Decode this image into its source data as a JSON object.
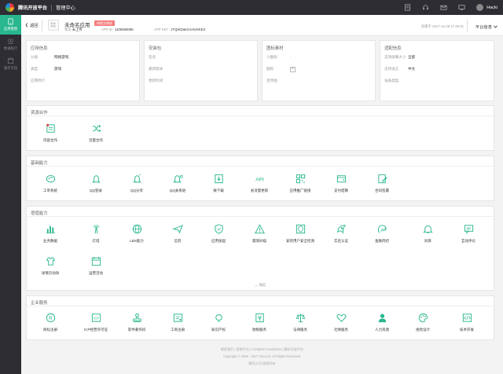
{
  "topbar": {
    "brand": "腾讯开放平台",
    "console": "管理中心",
    "user": "Hacki"
  },
  "sidebar": {
    "items": [
      {
        "label": "应用管理",
        "icon": "app-icon",
        "active": true
      },
      {
        "label": "数据统计",
        "icon": "chart-icon",
        "active": false
      },
      {
        "label": "服务市场",
        "icon": "store-icon",
        "active": false
      }
    ]
  },
  "app": {
    "back": "返回",
    "name": "未命名应用",
    "badge": "待提交审核",
    "status_label": "状态",
    "status_value": "未上传",
    "appid_label": "APP ID",
    "appid_value": "1106550096",
    "appkey_label": "APP KEY",
    "appkey_value": "zTQIKDaKrncHUSKE3",
    "created": "创建于 2017-12-28 17:49:31",
    "platform": "平台信息"
  },
  "cards": [
    {
      "title": "应用信息",
      "rows": [
        {
          "label": "分类",
          "value": "网络游戏"
        },
        {
          "label": "类型",
          "value": "游戏"
        },
        {
          "label": "应用简介",
          "value": ""
        }
      ]
    },
    {
      "title": "安装包",
      "rows": [
        {
          "label": "包名",
          "value": ""
        },
        {
          "label": "最新版本",
          "value": ""
        },
        {
          "label": "更新时间",
          "value": ""
        }
      ]
    },
    {
      "title": "图标素材",
      "rows": [
        {
          "label": "小图标",
          "value": ""
        },
        {
          "label": "图标",
          "value": ""
        },
        {
          "label": "宣传图",
          "value": ""
        }
      ]
    },
    {
      "title": "适配信息",
      "rows": [
        {
          "label": "支持屏幕大小",
          "value": "全部"
        },
        {
          "label": "支持语言",
          "value": "中文"
        },
        {
          "label": "设备类型",
          "value": ""
        }
      ]
    }
  ],
  "sections": {
    "resources": {
      "title": "资源合作",
      "items": [
        {
          "label": "内容合作",
          "icon": "content-icon"
        },
        {
          "label": "流量合作",
          "icon": "shuffle-icon"
        }
      ]
    },
    "basic": {
      "title": "基础能力",
      "items": [
        {
          "label": "工单系统",
          "icon": "ticket-icon"
        },
        {
          "label": "QQ登录",
          "icon": "qq-icon"
        },
        {
          "label": "QQ分享",
          "icon": "qq-share-icon"
        },
        {
          "label": "QQ关系链",
          "icon": "qq-relation-icon"
        },
        {
          "label": "微下载",
          "icon": "download-icon"
        },
        {
          "label": "省流量更新",
          "icon": "api-icon"
        },
        {
          "label": "应用推广链接",
          "icon": "qrcode-icon"
        },
        {
          "label": "支付结算",
          "icon": "wallet-icon"
        },
        {
          "label": "合同签署",
          "icon": "contract-icon"
        }
      ]
    },
    "enhanced": {
      "title": "增值能力",
      "items": [
        {
          "label": "业务数据",
          "icon": "bar-chart-icon"
        },
        {
          "label": "灯塔",
          "icon": "tower-icon"
        },
        {
          "label": "LBS能力",
          "icon": "globe-icon"
        },
        {
          "label": "信鸽",
          "icon": "pigeon-icon"
        },
        {
          "label": "应用加固",
          "icon": "shield-icon"
        },
        {
          "label": "漏洞扫描",
          "icon": "warning-icon"
        },
        {
          "label": "安装用户安全检测",
          "icon": "security-check-icon"
        },
        {
          "label": "实名认证",
          "icon": "id-icon"
        },
        {
          "label": "金融风控",
          "icon": "risk-icon"
        },
        {
          "label": "天御",
          "icon": "bell-icon"
        },
        {
          "label": "互动评论",
          "icon": "comment-icon"
        },
        {
          "label": "详情页动效",
          "icon": "gift-icon"
        },
        {
          "label": "运营活动",
          "icon": "calendar-icon"
        }
      ],
      "collapse": "收起"
    },
    "enterprise": {
      "title": "企业服务",
      "items": [
        {
          "label": "商标注册",
          "icon": "trademark-icon"
        },
        {
          "label": "ICP经营许可证",
          "icon": "icp-icon"
        },
        {
          "label": "软件著作权",
          "icon": "stamp-icon"
        },
        {
          "label": "工商注册",
          "icon": "business-icon"
        },
        {
          "label": "知识产权",
          "icon": "bulb-icon"
        },
        {
          "label": "财税服务",
          "icon": "tax-icon"
        },
        {
          "label": "法律服务",
          "icon": "scale-icon"
        },
        {
          "label": "社保服务",
          "icon": "heart-icon"
        },
        {
          "label": "人力资源",
          "icon": "person-icon"
        },
        {
          "label": "视觉设计",
          "icon": "palette-icon"
        },
        {
          "label": "技术开发",
          "icon": "code-icon"
        }
      ]
    }
  },
  "footer": {
    "links": "联系我们 | 营销平台 | Complete Guidelines | 腾讯开放平台",
    "copyright": "Copyright © 1998 - 2017 Tencent. All Rights Reserved.",
    "company": "腾讯公司 版权所有"
  },
  "colors": {
    "accent": "#28b78e",
    "dark": "#2d2d33",
    "badge": "#f47c7c"
  }
}
